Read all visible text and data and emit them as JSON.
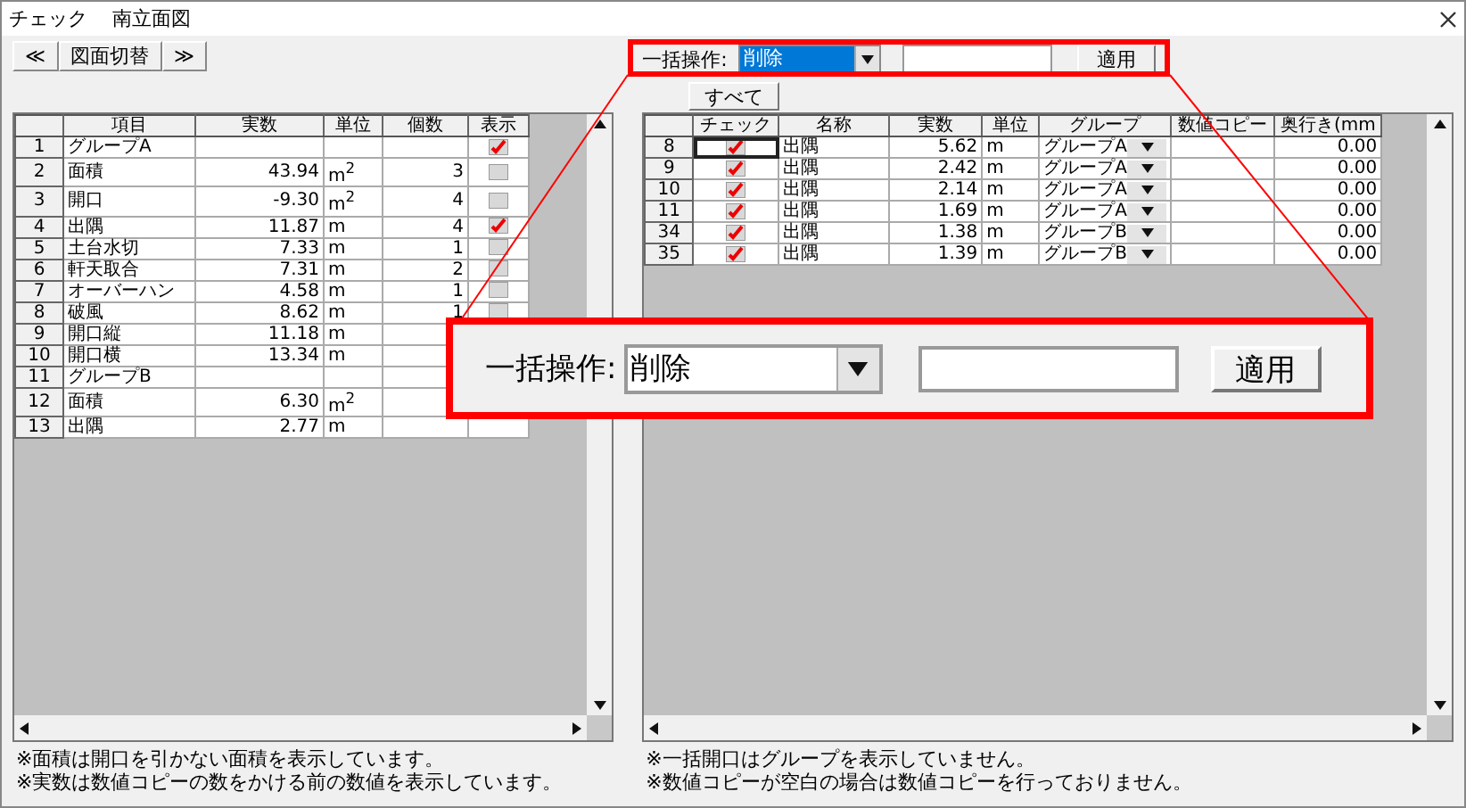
{
  "window": {
    "title": "チェック",
    "subtitle": "南立面図"
  },
  "nav": {
    "prev": "≪",
    "label": "図面切替",
    "next": "≫"
  },
  "left_table": {
    "columns": [
      "項目",
      "実数",
      "単位",
      "個数",
      "表示"
    ],
    "rows": [
      {
        "number": "1",
        "item": "グループA",
        "shown": true
      },
      {
        "number": "2",
        "item": "面積",
        "value": "43.94",
        "unit": "m$^{2}$",
        "count": "3",
        "shown": false
      },
      {
        "number": "3",
        "item": "開口",
        "value": "-9.30",
        "unit": "m$^{2}$",
        "count": "4",
        "shown": false
      },
      {
        "number": "4",
        "item": "出隅",
        "value": "11.87",
        "unit": "m",
        "count": "4",
        "shown": true
      },
      {
        "number": "5",
        "item": "土台水切",
        "value": "7.33",
        "unit": "m",
        "count": "1",
        "shown": false
      },
      {
        "number": "6",
        "item": "軒天取合",
        "value": "7.31",
        "unit": "m",
        "count": "2",
        "shown": false
      },
      {
        "number": "7",
        "item": "オーバーハン",
        "value": "4.58",
        "unit": "m",
        "count": "1",
        "shown": false
      },
      {
        "number": "8",
        "item": "破風",
        "value": "8.62",
        "unit": "m",
        "count": "1",
        "shown": false
      },
      {
        "number": "9",
        "item": "開口縦",
        "value": "11.18",
        "unit": "m"
      },
      {
        "number": "10",
        "item": "開口横",
        "value": "13.34",
        "unit": "m"
      },
      {
        "number": "11",
        "item": "グループB"
      },
      {
        "number": "12",
        "item": "面積",
        "value": "6.30",
        "unit": "m$^{2}$"
      },
      {
        "number": "13",
        "item": "出隅",
        "value": "2.77",
        "unit": "m"
      }
    ]
  },
  "left_notes": [
    "※面積は開口を引かない面積を表示しています。",
    "※実数は数値コピーの数をかける前の数値を表示しています。"
  ],
  "bulk": {
    "label": "一括操作:",
    "action": "削除",
    "action_selected": true,
    "apply": "適用"
  },
  "all_button": "すべて",
  "right_table": {
    "columns": [
      "チェック",
      "名称",
      "実数",
      "単位",
      "グループ",
      "数値コピー",
      "奥行き(mm"
    ],
    "rows": [
      {
        "number": "8",
        "checked": true,
        "focused": true,
        "name": "出隅",
        "value": "5.62",
        "unit": "m",
        "group": "グループA",
        "depth": "0.00"
      },
      {
        "number": "9",
        "checked": true,
        "focused": false,
        "name": "出隅",
        "value": "2.42",
        "unit": "m",
        "group": "グループA",
        "depth": "0.00"
      },
      {
        "number": "10",
        "checked": true,
        "focused": false,
        "name": "出隅",
        "value": "2.14",
        "unit": "m",
        "group": "グループA",
        "depth": "0.00"
      },
      {
        "number": "11",
        "checked": true,
        "focused": false,
        "name": "出隅",
        "value": "1.69",
        "unit": "m",
        "group": "グループA",
        "depth": "0.00"
      },
      {
        "number": "34",
        "checked": true,
        "focused": false,
        "name": "出隅",
        "value": "1.38",
        "unit": "m",
        "group": "グループB",
        "depth": "0.00"
      },
      {
        "number": "35",
        "checked": true,
        "focused": false,
        "name": "出隅",
        "value": "1.39",
        "unit": "m",
        "group": "グループB",
        "depth": "0.00"
      }
    ]
  },
  "right_notes": [
    "※一括開口はグループを表示していません。",
    "※数値コピーが空白の場合は数値コピーを行っておりません。"
  ],
  "callout": {
    "label": "一括操作:",
    "action": "削除",
    "apply": "適用"
  }
}
